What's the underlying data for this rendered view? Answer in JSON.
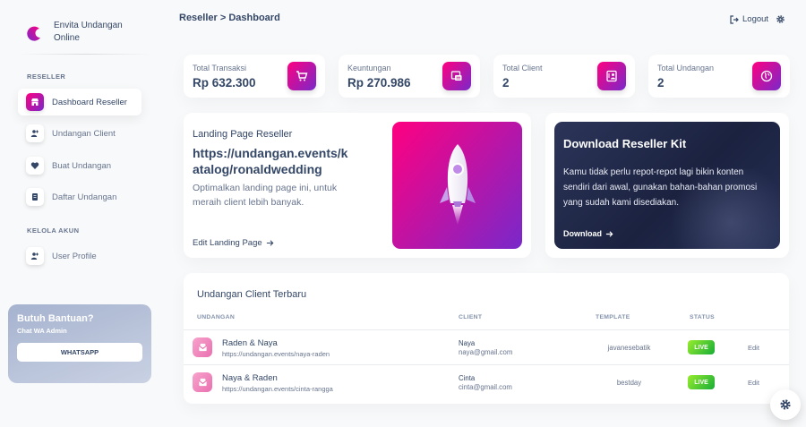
{
  "brand": {
    "name": "Envita Undangan Online"
  },
  "sidebar": {
    "section_reseller": "RESELLER",
    "section_account": "KELOLA AKUN",
    "items": [
      {
        "label": "Dashboard Reseller",
        "icon": "store-icon"
      },
      {
        "label": "Undangan Client",
        "icon": "users-icon"
      },
      {
        "label": "Buat Undangan",
        "icon": "heart-icon"
      },
      {
        "label": "Daftar Undangan",
        "icon": "list-icon"
      },
      {
        "label": "User Profile",
        "icon": "user-icon"
      }
    ],
    "help": {
      "title": "Butuh Bantuan?",
      "subtitle": "Chat WA Admin",
      "button": "WHATSAPP"
    }
  },
  "header": {
    "breadcrumb": "Reseller > Dashboard",
    "logout": "Logout"
  },
  "stats": [
    {
      "label": "Total Transaksi",
      "value": "Rp 632.300",
      "icon": "cart-icon"
    },
    {
      "label": "Keuntungan",
      "value": "Rp 270.986",
      "icon": "wallet-icon"
    },
    {
      "label": "Total Client",
      "value": "2",
      "icon": "client-icon"
    },
    {
      "label": "Total Undangan",
      "value": "2",
      "icon": "globe-icon"
    }
  ],
  "landing": {
    "label": "Landing Page Reseller",
    "url": "https://undangan.events/katalog/ronaldwedding",
    "description": "Optimalkan landing page ini, untuk meraih client lebih banyak.",
    "link": "Edit Landing Page"
  },
  "kit": {
    "title": "Download Reseller Kit",
    "description": "Kamu tidak perlu repot-repot lagi bikin konten sendiri dari awal, gunakan bahan-bahan promosi yang sudah kami disediakan.",
    "link": "Download"
  },
  "table": {
    "title": "Undangan Client Terbaru",
    "headers": {
      "undangan": "UNDANGAN",
      "client": "CLIENT",
      "template": "TEMPLATE",
      "status": "STATUS"
    },
    "rows": [
      {
        "name": "Raden & Naya",
        "url": "https://undangan.events/naya-raden",
        "client": "Naya",
        "email": "naya@gmail.com",
        "template": "javanesebatik",
        "status": "LIVE",
        "action": "Edit"
      },
      {
        "name": "Naya & Raden",
        "url": "https://undangan.events/cinta-rangga",
        "client": "Cinta",
        "email": "cinta@gmail.com",
        "template": "bestday",
        "status": "LIVE",
        "action": "Edit"
      }
    ]
  },
  "colors": {
    "accent_start": "#7928ca",
    "accent_end": "#ff0080",
    "live_badge": "#17ad37",
    "text": "#344767"
  }
}
